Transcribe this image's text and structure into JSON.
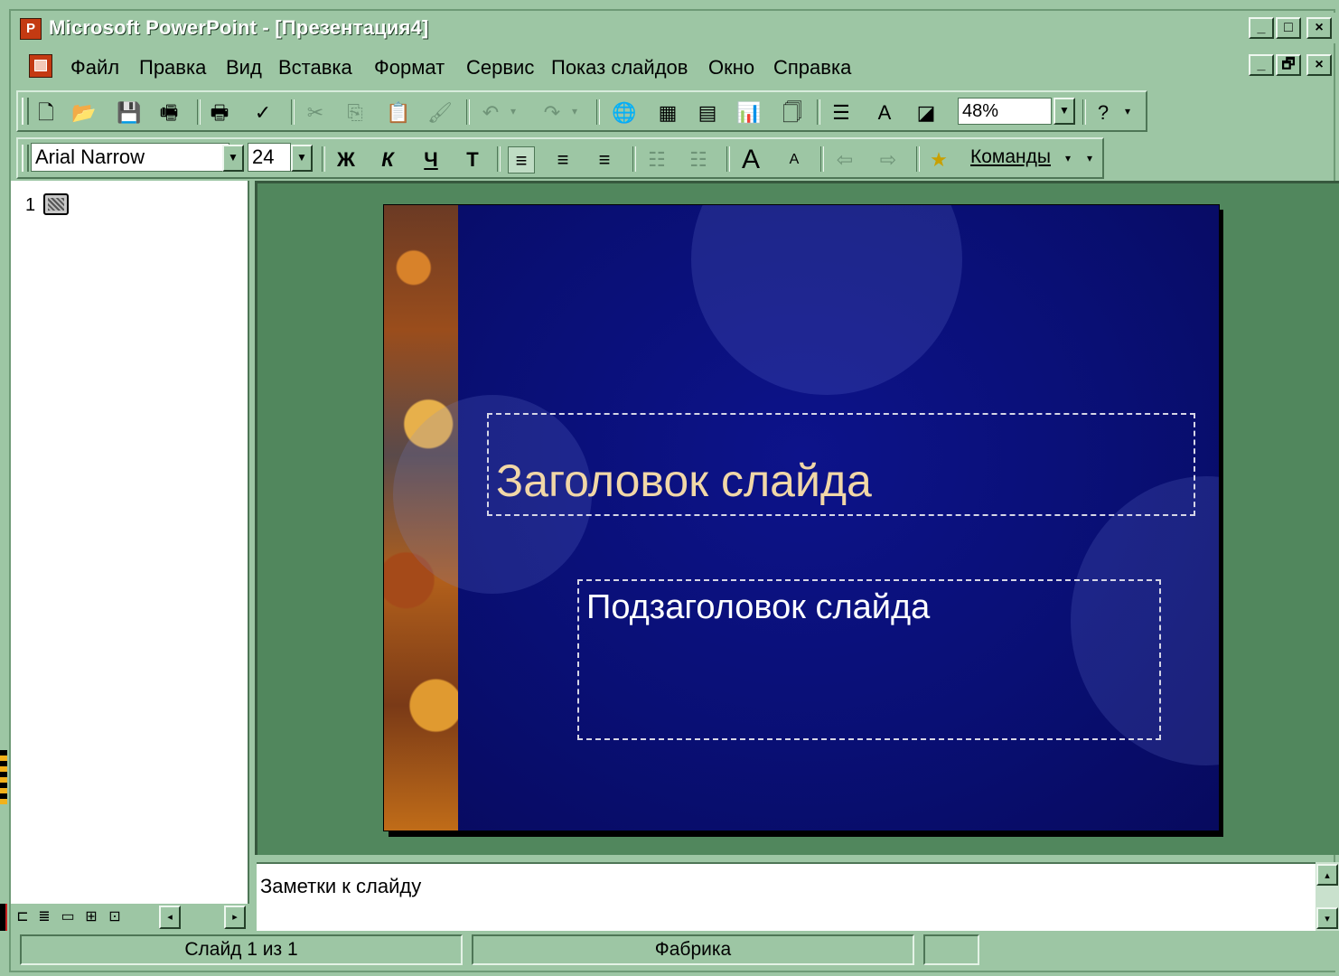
{
  "window": {
    "title": "Microsoft PowerPoint - [Презентация4]",
    "app_icon_glyph": "P",
    "controls": [
      "_",
      "□",
      "×"
    ],
    "doc_controls": [
      "_",
      "🗗",
      "×"
    ]
  },
  "menu": [
    "Файл",
    "Правка",
    "Вид",
    "Вставка",
    "Формат",
    "Сервис",
    "Показ слайдов",
    "Окно",
    "Справка"
  ],
  "standard_toolbar": {
    "zoom": "48%"
  },
  "formatting_toolbar": {
    "font": "Arial Narrow",
    "size": "24",
    "bold": "Ж",
    "italic": "К",
    "underline": "Ч",
    "shadow": "Т",
    "commands_label": "Команды"
  },
  "outline": {
    "slide_number": "1"
  },
  "slide": {
    "title": "Заголовок слайда",
    "subtitle": "Подзаголовок слайда"
  },
  "notes": {
    "text": "Заметки к слайду"
  },
  "status": {
    "slide_info": "Слайд 1 из 1",
    "design": "Фабрика"
  },
  "colors": {
    "chrome": "#9dc6a4",
    "workspace": "#51875d",
    "slide_bg": "#090f74",
    "title_text": "#f1d7a7"
  }
}
